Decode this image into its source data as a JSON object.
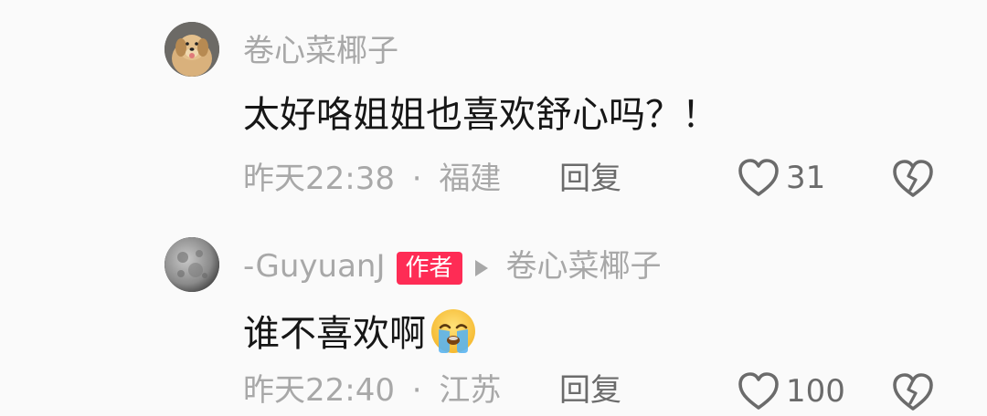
{
  "comments": [
    {
      "username": "卷心菜椰子",
      "text": "太好咯姐姐也喜欢舒心吗？！",
      "time": "昨天22:38",
      "separator": "·",
      "location": "福建",
      "reply_label": "回复",
      "likes": "31",
      "avatar_icon": "puppy-avatar",
      "like_icon": "heart-outline-icon",
      "dislike_icon": "broken-heart-icon"
    },
    {
      "username": "-GuyuanJ",
      "author_badge": "作者",
      "reply_to": "卷心菜椰子",
      "text": "谁不喜欢啊",
      "emoji": "crying-face-emoji",
      "time": "昨天22:40",
      "separator": "·",
      "location": "江苏",
      "reply_label": "回复",
      "likes": "100",
      "avatar_icon": "moon-avatar",
      "like_icon": "heart-outline-icon",
      "dislike_icon": "broken-heart-icon"
    }
  ],
  "colors": {
    "background": "#fafafa",
    "primary_text": "#161616",
    "secondary_text": "#a8a8a8",
    "action_text": "#6b6b6b",
    "author_badge": "#fe2c55"
  }
}
